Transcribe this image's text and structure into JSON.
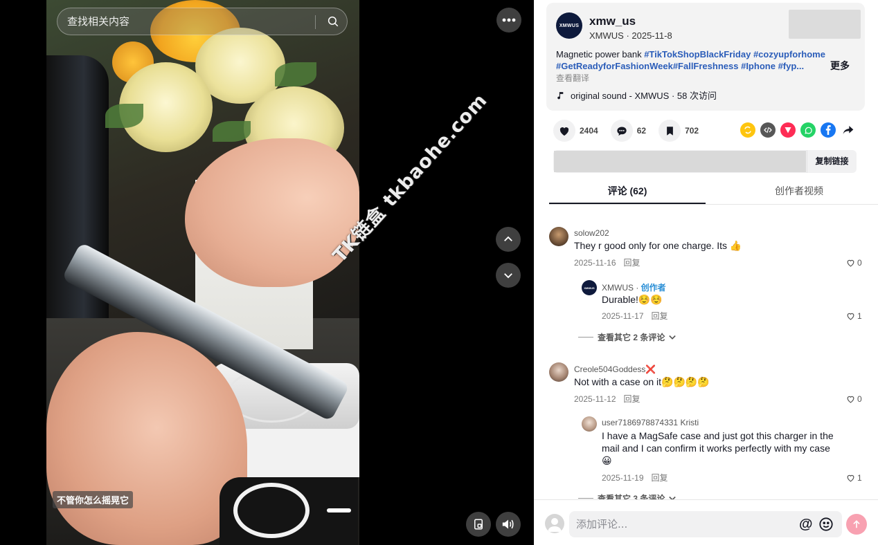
{
  "video": {
    "search_placeholder": "查找相关内容",
    "caption": "不管你怎么摇晃它",
    "watermark": "TK链盒 tkbaohe.com"
  },
  "post": {
    "author_avatar_text": "XMWUS",
    "author_name": "xmw_us",
    "author_sub": "XMWUS · 2025-11-8",
    "desc_text": "Magnetic power bank ",
    "hashtags": [
      "#TikTokShopBlackFriday",
      "#cozyupforhome",
      "#GetReadyforFashionWeek",
      "#FallFreshness",
      "#Iphone",
      "#fyp..."
    ],
    "more": "更多",
    "translate": "查看翻译",
    "sound": "original sound - XMWUS · 58 次访问"
  },
  "actions": {
    "likes": "2404",
    "comments": "62",
    "favorites": "702"
  },
  "share_icons": [
    "repost-icon",
    "embed-icon",
    "send-icon",
    "whatsapp-icon",
    "facebook-icon",
    "share-arrow-icon"
  ],
  "link": {
    "copy_label": "复制链接"
  },
  "tabs": {
    "comments": "评论 (62)",
    "creator_videos": "创作者视频"
  },
  "comments": [
    {
      "user": "solow202",
      "text": "They r good only for one charge. Its 👍",
      "date": "2025-11-16",
      "reply": "回复",
      "likes": "0",
      "replies": [
        {
          "user": "XMWUS",
          "badge": "创作者",
          "text": "Durable!☺️☺️",
          "date": "2025-11-17",
          "reply": "回复",
          "likes": "1"
        }
      ],
      "more_replies": "查看其它 2 条评论"
    },
    {
      "user": "Creole504Goddess❌",
      "text": "Not with a case on it🤔🤔🤔🤔",
      "date": "2025-11-12",
      "reply": "回复",
      "likes": "0",
      "replies": [
        {
          "user": "user7186978874331 Kristi",
          "text": "I have a MagSafe case and just got this charger in the mail and I can confirm it works perfectly with my case 😀",
          "date": "2025-11-19",
          "reply": "回复",
          "likes": "1"
        }
      ],
      "more_replies": "查看其它 3 条评论"
    }
  ],
  "composer": {
    "placeholder": "添加评论...",
    "at": "@"
  },
  "colors": {
    "hashtag": "#2b5db9",
    "creator_badge": "#2b8fd6",
    "send_button": "#f8a1b1"
  }
}
